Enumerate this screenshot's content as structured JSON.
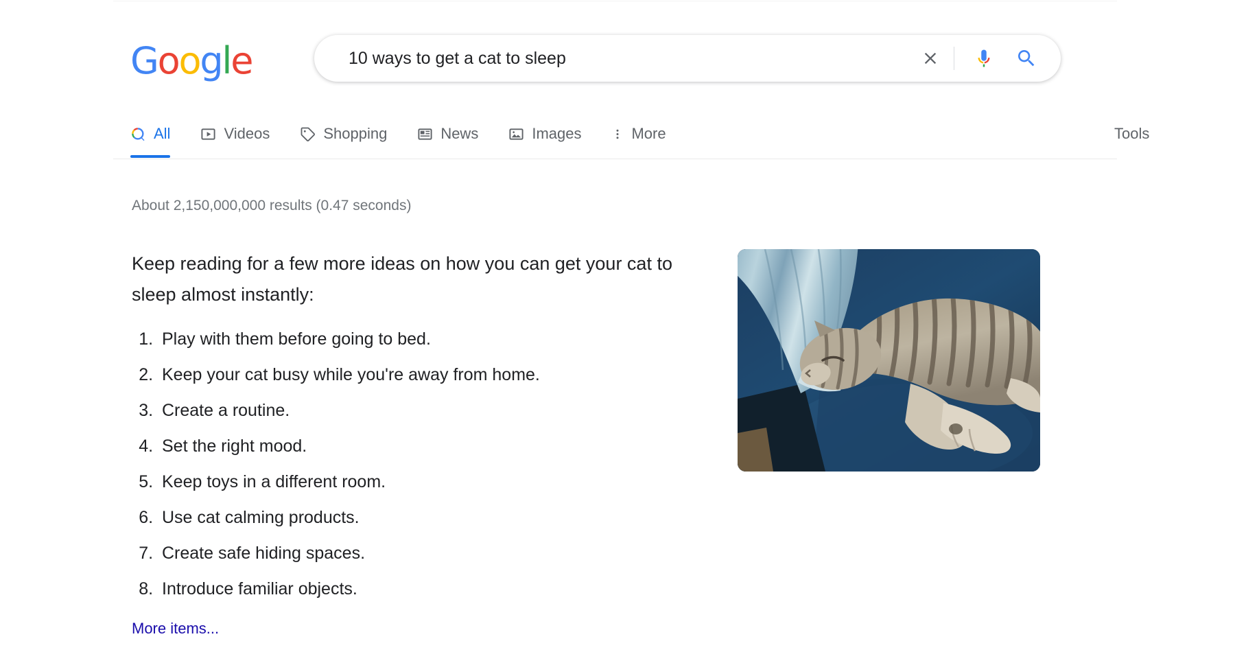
{
  "brand": {
    "logo_letters": [
      {
        "char": "G",
        "color": "#4285F4"
      },
      {
        "char": "o",
        "color": "#EA4335"
      },
      {
        "char": "o",
        "color": "#FBBC05"
      },
      {
        "char": "g",
        "color": "#4285F4"
      },
      {
        "char": "l",
        "color": "#34A853"
      },
      {
        "char": "e",
        "color": "#EA4335"
      }
    ],
    "logo_text": "Google"
  },
  "search": {
    "query": "10 ways to get a cat to sleep",
    "placeholder": "Search",
    "clear_icon": "close-icon",
    "mic_icon": "microphone-icon",
    "search_icon": "search-icon"
  },
  "nav": {
    "tabs": [
      {
        "label": "All",
        "icon": "search-icon",
        "active": true
      },
      {
        "label": "Videos",
        "icon": "video-icon",
        "active": false
      },
      {
        "label": "Shopping",
        "icon": "tag-icon",
        "active": false
      },
      {
        "label": "News",
        "icon": "newspaper-icon",
        "active": false
      },
      {
        "label": "Images",
        "icon": "image-icon",
        "active": false
      },
      {
        "label": "More",
        "icon": "more-vertical-icon",
        "active": false
      }
    ],
    "tools_label": "Tools"
  },
  "results": {
    "stats": "About 2,150,000,000 results (0.47 seconds)",
    "snippet": {
      "title": "Keep reading for a few more ideas on how you can get your cat to sleep almost instantly:",
      "items": [
        "Play with them before going to bed.",
        "Keep your cat busy while you're away from home.",
        "Create a routine.",
        "Set the right mood.",
        "Keep toys in a different room.",
        "Use cat calming products.",
        "Create safe hiding spaces.",
        "Introduce familiar objects."
      ],
      "more_items_label": "More items..."
    },
    "thumbnail": {
      "alt": "Tabby cat sleeping on a blue couch next to denim jeans",
      "name": "sleeping-cat-photo"
    }
  },
  "colors": {
    "google_blue": "#4285F4",
    "google_red": "#EA4335",
    "google_yellow": "#FBBC05",
    "google_green": "#34A853",
    "active_tab": "#1a73e8",
    "link": "#1a0dab",
    "muted_text": "#70757a",
    "body_text": "#202124"
  }
}
